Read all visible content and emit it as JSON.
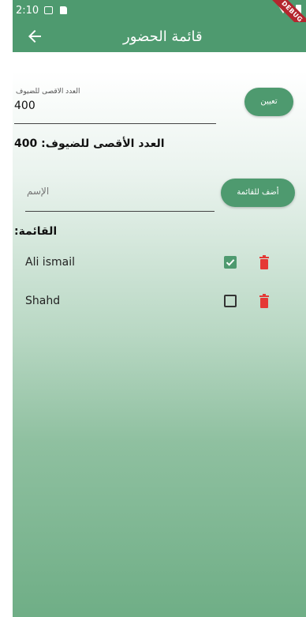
{
  "status_bar": {
    "time": "2:10",
    "debug_label": "DEBUG"
  },
  "app_bar": {
    "title": "قائمة الحضور",
    "back_icon": "arrow-back-icon"
  },
  "max_guests_field": {
    "label": "العدد الاقصى للضيوف",
    "value": "400"
  },
  "set_button": {
    "label": "تعيين"
  },
  "max_guests_display": {
    "text": "العدد الأقصى للضيوف: 400"
  },
  "name_field": {
    "placeholder": "الإسم",
    "value": ""
  },
  "add_button": {
    "label": "أضف للقائمة"
  },
  "list": {
    "heading": ":القائمة",
    "items": [
      {
        "name": "Ali ismail",
        "checked": true,
        "delete_icon": "trash-icon"
      },
      {
        "name": "Shahd",
        "checked": false,
        "delete_icon": "trash-icon"
      }
    ]
  },
  "colors": {
    "primary": "#4e9a6f",
    "delete": "#e53935",
    "checkbox_checked": "#4e9a6f"
  }
}
